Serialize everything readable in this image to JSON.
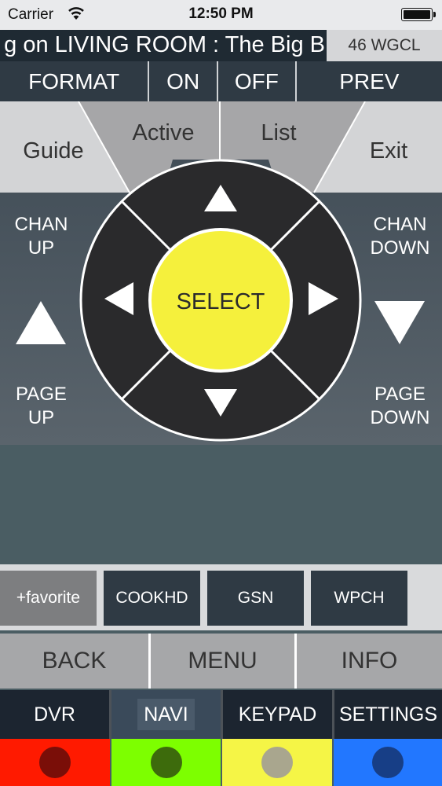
{
  "status_bar": {
    "carrier": "Carrier",
    "time": "12:50 PM"
  },
  "now_playing": {
    "ticker": "g on LIVING ROOM : The Big B",
    "channel": "46 WGCL"
  },
  "top_buttons": [
    {
      "name": "format",
      "label": "FORMAT"
    },
    {
      "name": "on",
      "label": "ON"
    },
    {
      "name": "off",
      "label": "OFF"
    },
    {
      "name": "prev",
      "label": "PREV"
    }
  ],
  "navigation": {
    "guide": "Guide",
    "active": "Active",
    "list": "List",
    "exit": "Exit",
    "select": "SELECT",
    "chan_up": [
      "CHAN",
      "UP"
    ],
    "chan_down": [
      "CHAN",
      "DOWN"
    ],
    "page_up": [
      "PAGE",
      "UP"
    ],
    "page_down": [
      "PAGE",
      "DOWN"
    ]
  },
  "favorites": {
    "add_label": "+favorite",
    "channels": [
      "COOKHD",
      "GSN",
      "WPCH"
    ]
  },
  "control_buttons": {
    "back": "BACK",
    "menu": "MENU",
    "info": "INFO"
  },
  "tabs": [
    {
      "name": "dvr",
      "label": "DVR"
    },
    {
      "name": "navi",
      "label": "NAVI",
      "active": true
    },
    {
      "name": "keypad",
      "label": "KEYPAD"
    },
    {
      "name": "settings",
      "label": "SETTINGS"
    }
  ],
  "color_buttons": [
    {
      "name": "red",
      "color": "#ff1a00",
      "dot": "#7a0e08"
    },
    {
      "name": "green",
      "color": "#7dff00",
      "dot": "#3d6b0c"
    },
    {
      "name": "yellow",
      "color": "#f5f546",
      "dot": "#a9a68e"
    },
    {
      "name": "blue",
      "color": "#2277ff",
      "dot": "#173e86"
    }
  ],
  "colors": {
    "select": "#f5f03c",
    "dpad": "#2a2a2c",
    "top_bar": "#2f3a44"
  }
}
